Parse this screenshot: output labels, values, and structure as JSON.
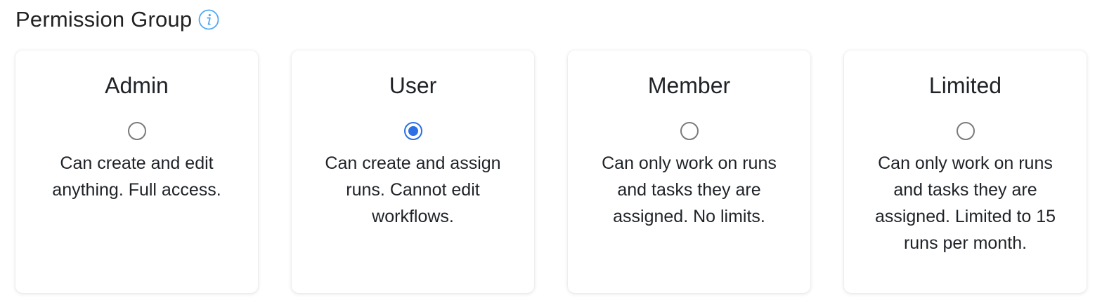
{
  "header": {
    "title": "Permission Group",
    "info_icon": "info-icon"
  },
  "colors": {
    "accent": "#2d6fe6",
    "info": "#52a8f0",
    "radio_border": "#7a7a7a"
  },
  "groups": [
    {
      "label": "Admin",
      "description": "Can create and edit anything. Full access.",
      "selected": false
    },
    {
      "label": "User",
      "description": "Can create and assign runs. Cannot edit workflows.",
      "selected": true
    },
    {
      "label": "Member",
      "description": "Can only work on runs and tasks they are assigned. No limits.",
      "selected": false
    },
    {
      "label": "Limited",
      "description": "Can only work on runs and tasks they are assigned. Limited to 15 runs per month.",
      "selected": false
    }
  ]
}
